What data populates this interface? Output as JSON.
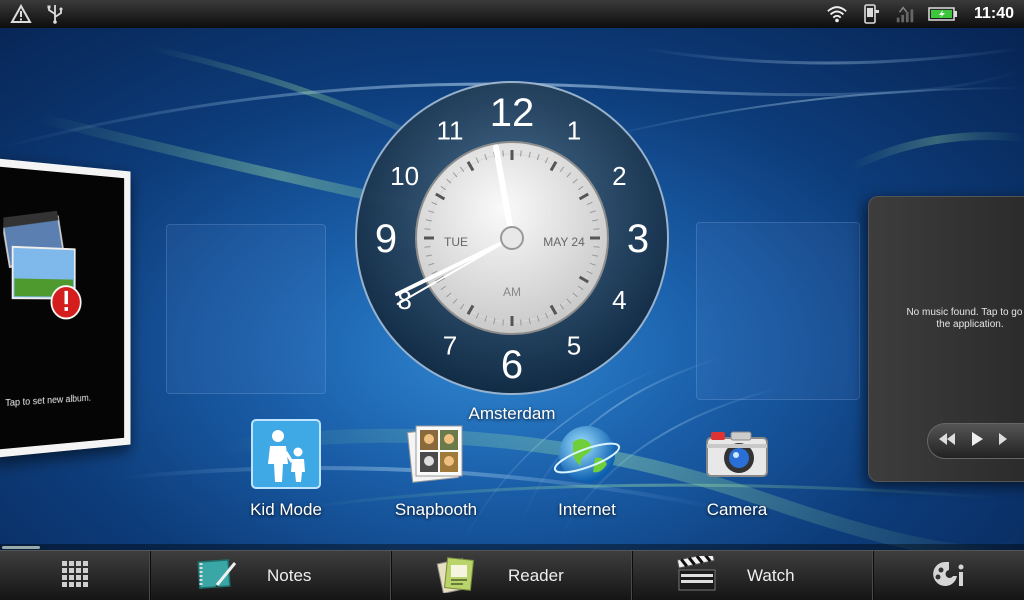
{
  "status_bar": {
    "left_icons": [
      "alert-triangle-icon",
      "usb-icon"
    ],
    "right_icons": [
      "wifi-icon",
      "phone-icon",
      "signal-icon",
      "battery-icon"
    ],
    "time": "11:40",
    "battery_color": "#3cc63c"
  },
  "clock": {
    "numbers": [
      "12",
      "1",
      "2",
      "3",
      "4",
      "5",
      "6",
      "7",
      "8",
      "9",
      "10",
      "11"
    ],
    "day": "TUE",
    "date": "MAY 24",
    "ampm": "AM",
    "city": "Amsterdam",
    "time": "11:40",
    "seconds": 40
  },
  "photo_widget": {
    "caption": "Tap to set new album."
  },
  "music_widget": {
    "message": "No music found. Tap to go to the application."
  },
  "shortcuts": [
    {
      "label": "Kid Mode",
      "icon": "kid-mode-icon"
    },
    {
      "label": "Snapbooth",
      "icon": "snapbooth-icon"
    },
    {
      "label": "Internet",
      "icon": "internet-globe-icon"
    },
    {
      "label": "Camera",
      "icon": "camera-icon"
    }
  ],
  "bottom_bar": {
    "apps": [
      {
        "label": "Notes",
        "icon": "notes-icon"
      },
      {
        "label": "Reader",
        "icon": "reader-icon"
      },
      {
        "label": "Watch",
        "icon": "watch-clapper-icon"
      }
    ],
    "left_icon": "all-apps-grid-icon",
    "right_icon": "personalize-icon"
  }
}
